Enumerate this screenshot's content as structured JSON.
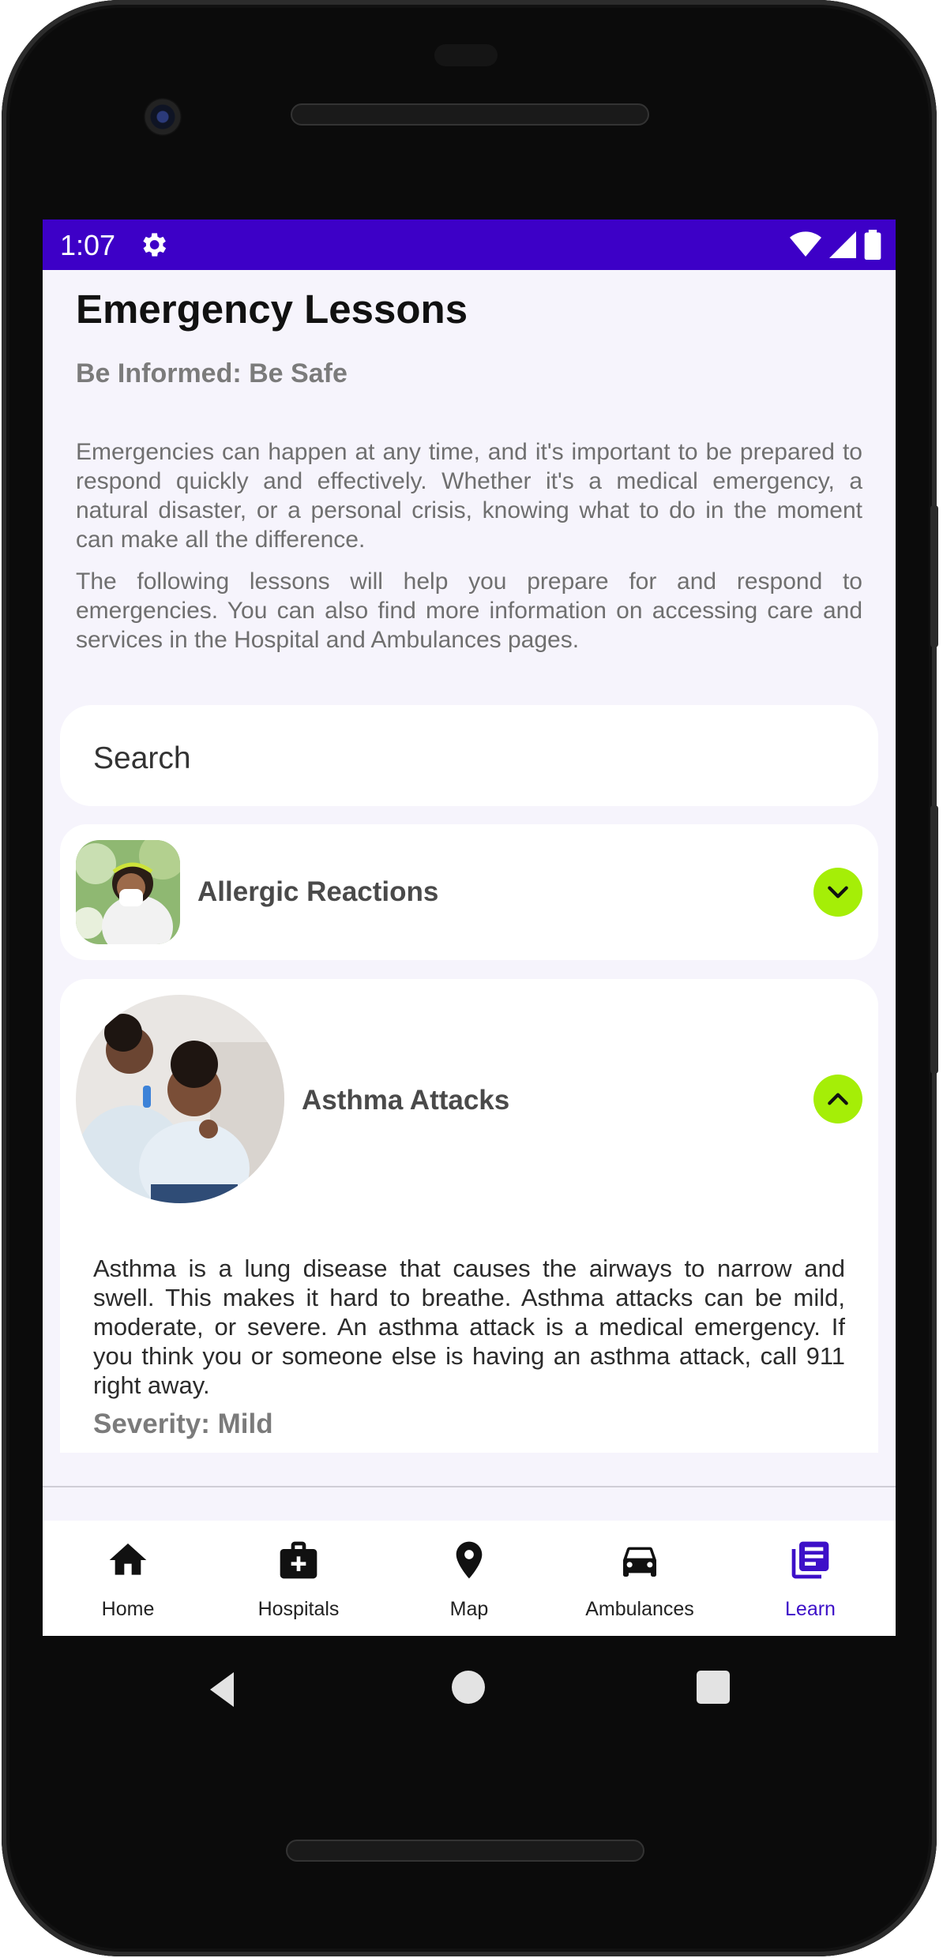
{
  "status_bar": {
    "time": "1:07",
    "icons": [
      "gear-icon",
      "wifi-icon",
      "cellular-icon",
      "battery-icon"
    ],
    "color": "#3d00c7"
  },
  "page": {
    "title": "Emergency Lessons",
    "subtitle": "Be Informed: Be Safe",
    "intro_1": "Emergencies can happen at any time, and it's important to be prepared to respond quickly and effectively. Whether it's a medical emergency, a natural disaster, or a personal crisis, knowing what to do in the moment can make all the difference.",
    "intro_2": "The following lessons will help you prepare for and respond to emergencies. You can also find more information on accessing care and services in the Hospital and Ambulances pages."
  },
  "search": {
    "placeholder": "Search"
  },
  "lessons": [
    {
      "title": "Allergic Reactions",
      "expanded": false,
      "toggle_icon": "chevron-down-icon"
    },
    {
      "title": "Asthma Attacks",
      "expanded": true,
      "toggle_icon": "chevron-up-icon",
      "body": "Asthma is a lung disease that causes the airways to narrow and swell. This makes it hard to breathe. Asthma attacks can be mild, moderate, or severe. An asthma attack is a medical emergency. If you think you or someone else is having an asthma attack, call 911 right away.",
      "severity": "Severity: Mild"
    }
  ],
  "bottom_nav": {
    "active": "Learn",
    "active_color": "#3d10c8",
    "items": [
      {
        "label": "Home",
        "icon": "home-icon"
      },
      {
        "label": "Hospitals",
        "icon": "medical-bag-icon"
      },
      {
        "label": "Map",
        "icon": "location-pin-icon"
      },
      {
        "label": "Ambulances",
        "icon": "car-icon"
      },
      {
        "label": "Learn",
        "icon": "library-books-icon"
      }
    ]
  },
  "accent_color": "#a5ee07"
}
